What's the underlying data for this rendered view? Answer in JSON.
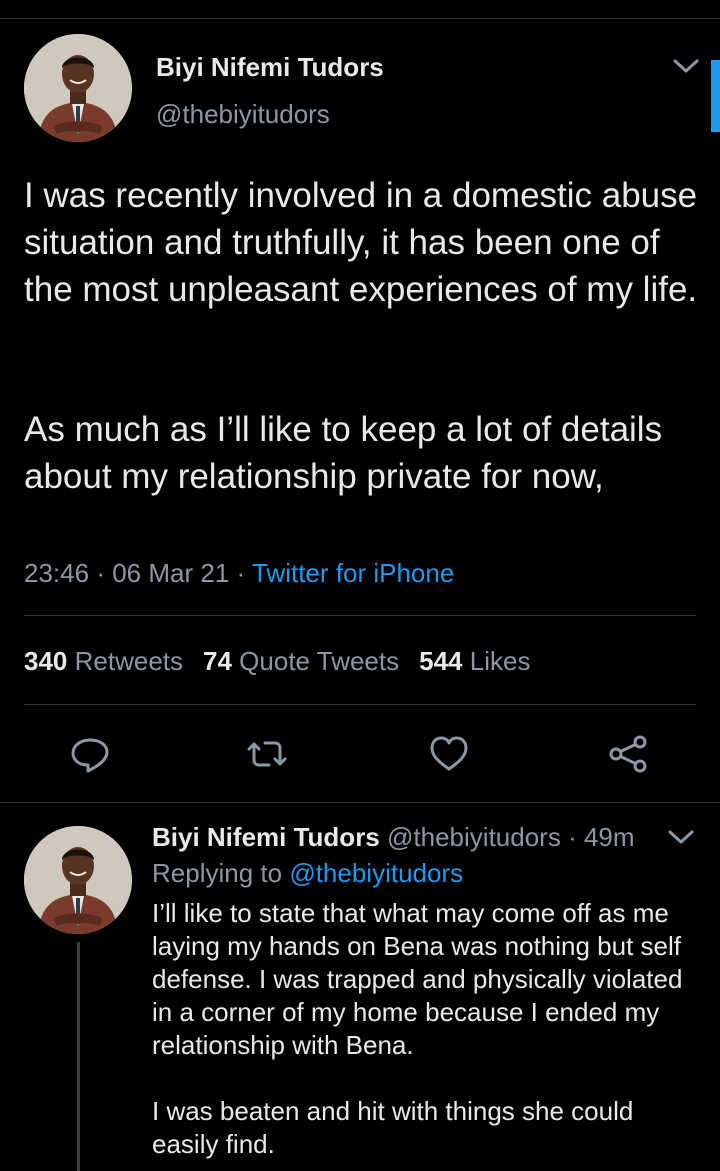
{
  "main_tweet": {
    "author_name": "Biyi Nifemi Tudors",
    "author_handle": "@thebiyitudors",
    "paragraph_1": "I was recently involved in a domestic abuse situation and truthfully, it has been one of the most unpleasant experiences of my life.",
    "paragraph_2": "As much as I’ll like to keep a lot of details about my relationship private for now,",
    "time": "23:46",
    "date": "06 Mar 21",
    "separator": "·",
    "source": "Twitter for iPhone",
    "stats": {
      "retweets_count": "340",
      "retweets_label": "Retweets",
      "quotes_count": "74",
      "quotes_label": "Quote Tweets",
      "likes_count": "544",
      "likes_label": "Likes"
    },
    "actions": {
      "reply_icon": "reply-icon",
      "retweet_icon": "retweet-icon",
      "like_icon": "heart-icon",
      "share_icon": "share-icon"
    }
  },
  "reply_tweet": {
    "author_name": "Biyi Nifemi Tudors",
    "author_handle": "@thebiyitudors",
    "time_ago": "49m",
    "separator": "·",
    "replying_label": "Replying to",
    "replying_to": "@thebiyitudors",
    "paragraph_1": "I’ll like to state that what may come off as me laying my hands on Bena was nothing but self defense. I was trapped and physically violated in a corner of my home because I ended my relationship with Bena.",
    "paragraph_2": "I was beaten and hit with things she could easily find."
  },
  "colors": {
    "background": "#000000",
    "text": "#e7e9ea",
    "secondary": "#8b98a5",
    "accent": "#1d9bf0",
    "divider": "#2f3336"
  }
}
